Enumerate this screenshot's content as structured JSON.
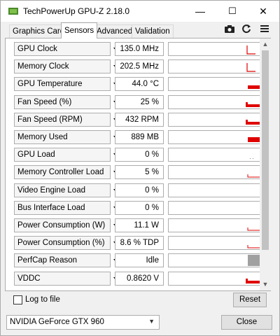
{
  "window": {
    "title": "TechPowerUp GPU-Z 2.18.0"
  },
  "titlebar": {
    "minimize": "—",
    "maximize": "☐",
    "close": "✕"
  },
  "tabs": [
    "Graphics Card",
    "Sensors",
    "Advanced",
    "Validation"
  ],
  "active_tab": "Sensors",
  "toolbar": {
    "camera_icon": "camera-icon",
    "refresh_icon": "refresh-icon",
    "menu_icon": "menu-icon"
  },
  "sensors": [
    {
      "name": "GPU Clock",
      "value": "135.0 MHz",
      "graph": "spike"
    },
    {
      "name": "Memory Clock",
      "value": "202.5 MHz",
      "graph": "spike"
    },
    {
      "name": "GPU Temperature",
      "value": "44.0 °C",
      "graph": "block"
    },
    {
      "name": "Fan Speed (%)",
      "value": "25 %",
      "graph": "block-low"
    },
    {
      "name": "Fan Speed (RPM)",
      "value": "432 RPM",
      "graph": "block-low"
    },
    {
      "name": "Memory Used",
      "value": "889 MB",
      "graph": "block-mid"
    },
    {
      "name": "GPU Load",
      "value": "0 %",
      "graph": "dots"
    },
    {
      "name": "Memory Controller Load",
      "value": "5 %",
      "graph": "line-low"
    },
    {
      "name": "Video Engine Load",
      "value": "0 %",
      "graph": "none"
    },
    {
      "name": "Bus Interface Load",
      "value": "0 %",
      "graph": "none"
    },
    {
      "name": "Power Consumption (W)",
      "value": "11.1 W",
      "graph": "line-low"
    },
    {
      "name": "Power Consumption (%)",
      "value": "8.6 % TDP",
      "graph": "line-low"
    },
    {
      "name": "PerfCap Reason",
      "value": "Idle",
      "graph": "grey"
    },
    {
      "name": "VDDC",
      "value": "0.8620 V",
      "graph": "block-low"
    }
  ],
  "footer": {
    "log_to_file": "Log to file",
    "reset": "Reset",
    "gpu_name": "NVIDIA GeForce GTX 960",
    "close": "Close"
  },
  "colors": {
    "graph": "#e00000",
    "perfcap": "#a0a0a0"
  }
}
